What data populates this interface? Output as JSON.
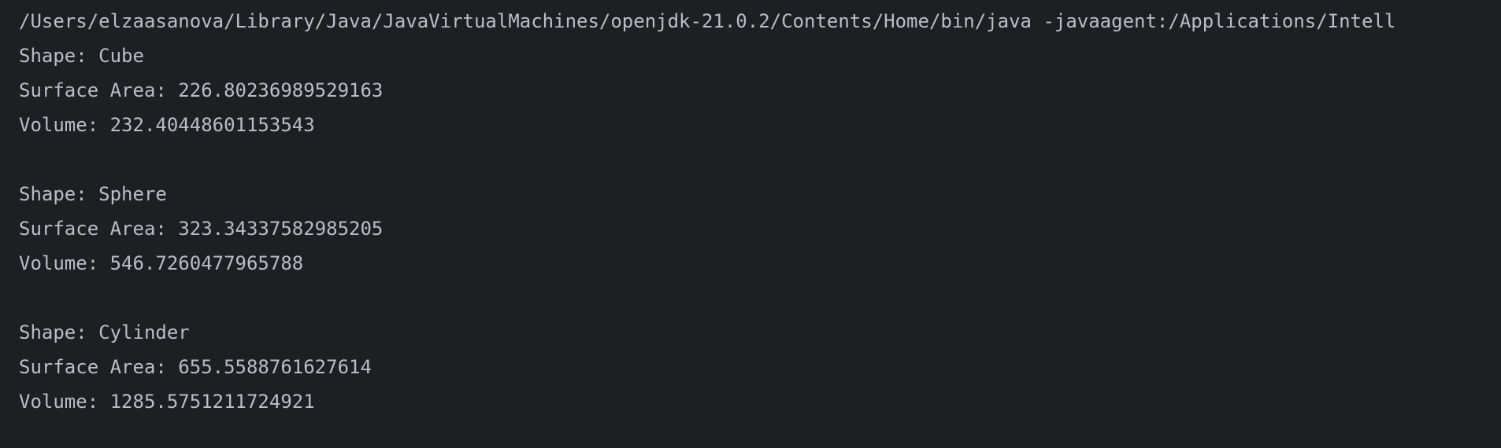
{
  "console": {
    "command": "/Users/elzaasanova/Library/Java/JavaVirtualMachines/openjdk-21.0.2/Contents/Home/bin/java -javaagent:/Applications/Intell",
    "blocks": [
      {
        "shape": "Shape: Cube",
        "surface_area": "Surface Area: 226.80236989529163",
        "volume": "Volume: 232.40448601153543"
      },
      {
        "shape": "Shape: Sphere",
        "surface_area": "Surface Area: 323.34337582985205",
        "volume": "Volume: 546.7260477965788"
      },
      {
        "shape": "Shape: Cylinder",
        "surface_area": "Surface Area: 655.5588761627614",
        "volume": "Volume: 1285.5751211724921"
      }
    ]
  },
  "colors": {
    "background": "#1e1f22",
    "text": "#bcbec4"
  }
}
